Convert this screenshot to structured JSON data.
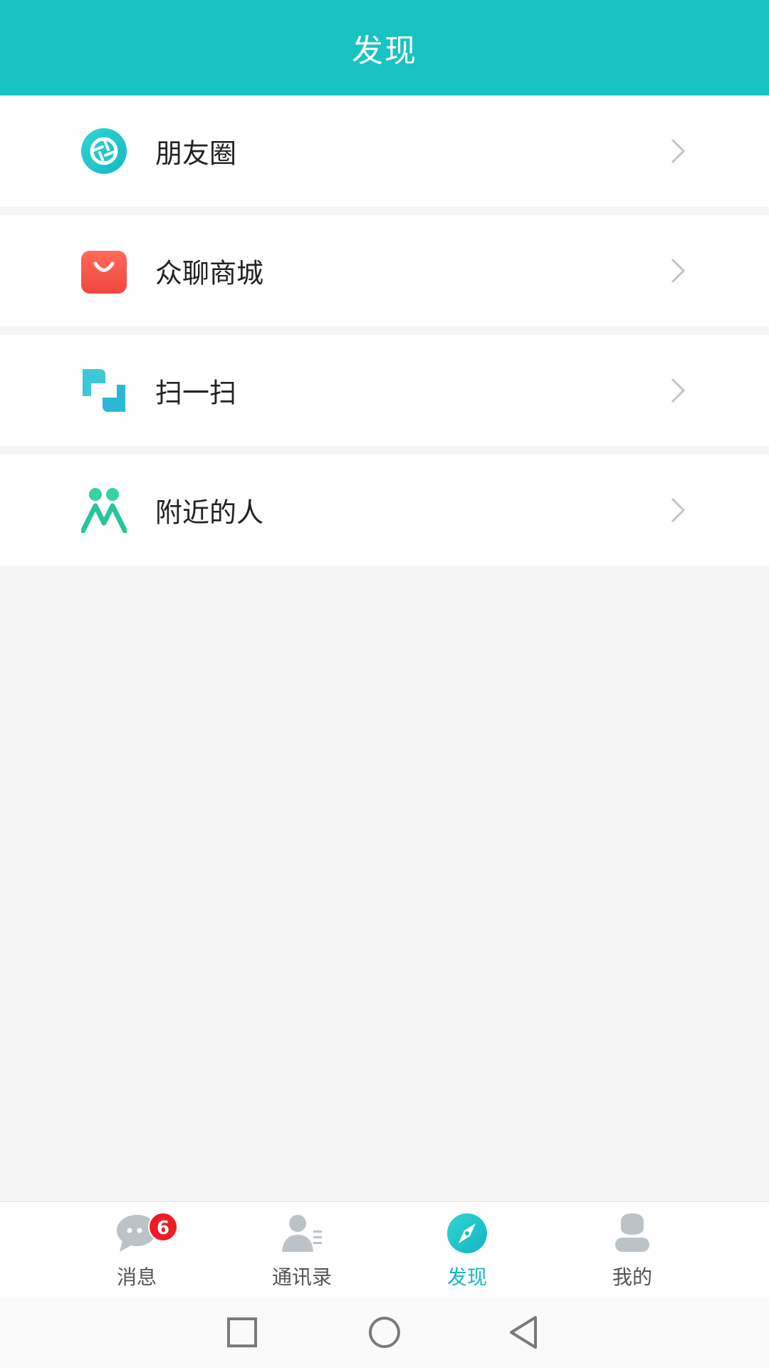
{
  "colors": {
    "accent": "#17c3c3",
    "active_tab": "#17b8c5",
    "badge": "#ee1c25"
  },
  "header": {
    "title": "发现"
  },
  "menu": {
    "items": [
      {
        "label": "朋友圈",
        "icon": "moments-aperture-icon"
      },
      {
        "label": "众聊商城",
        "icon": "shopping-bag-icon"
      },
      {
        "label": "扫一扫",
        "icon": "scan-icon"
      },
      {
        "label": "附近的人",
        "icon": "nearby-people-icon"
      }
    ]
  },
  "bottom_nav": {
    "tabs": [
      {
        "label": "消息",
        "icon": "chat-bubble-icon",
        "badge": "6",
        "active": false
      },
      {
        "label": "通讯录",
        "icon": "contacts-icon",
        "active": false
      },
      {
        "label": "发现",
        "icon": "compass-icon",
        "active": true
      },
      {
        "label": "我的",
        "icon": "profile-icon",
        "active": false
      }
    ]
  },
  "system_nav": {
    "buttons": [
      "recents-square-icon",
      "home-circle-icon",
      "back-triangle-icon"
    ]
  }
}
